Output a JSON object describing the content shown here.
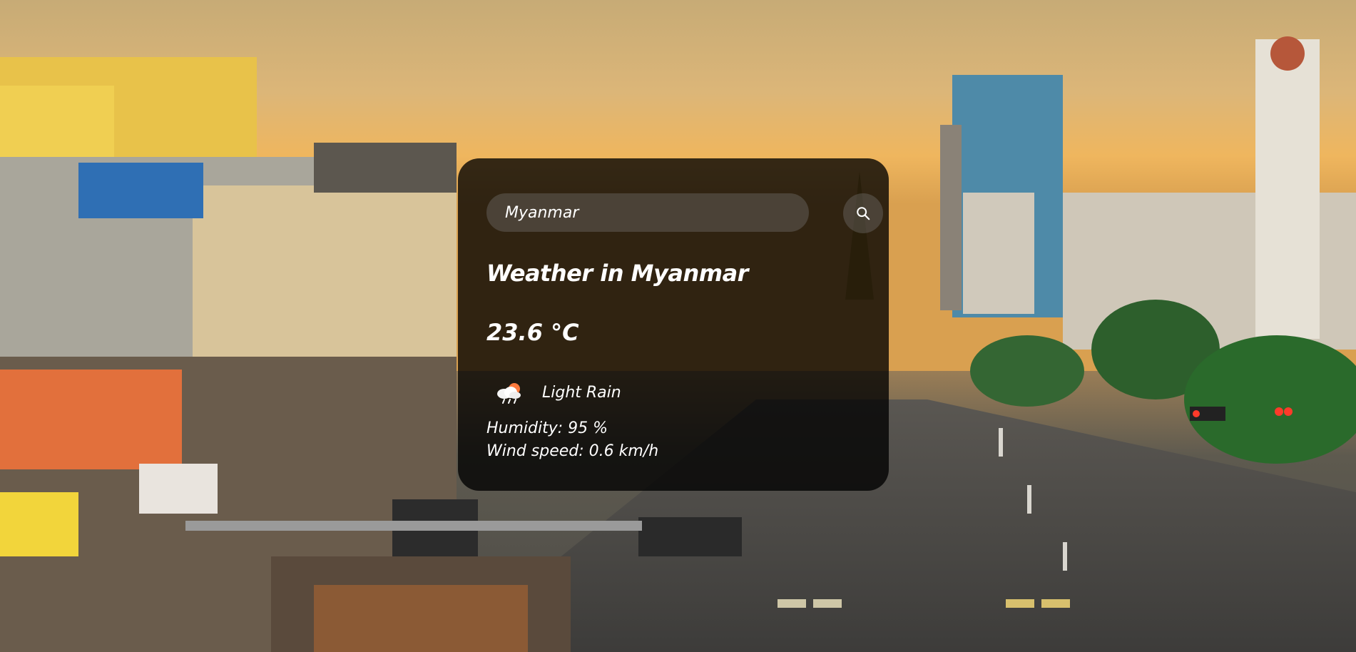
{
  "search": {
    "value": "Myanmar",
    "button_icon": "search-icon"
  },
  "weather": {
    "title": "Weather in Myanmar",
    "temperature": "23.6 °C",
    "condition_icon": "cloud-rain-icon",
    "condition": "Light Rain",
    "humidity": "Humidity: 95 %",
    "wind": "Wind speed: 0.6 km/h"
  },
  "colors": {
    "card_background": "#000000",
    "text": "#ffffff",
    "sun_accent": "#ff7a3d"
  }
}
